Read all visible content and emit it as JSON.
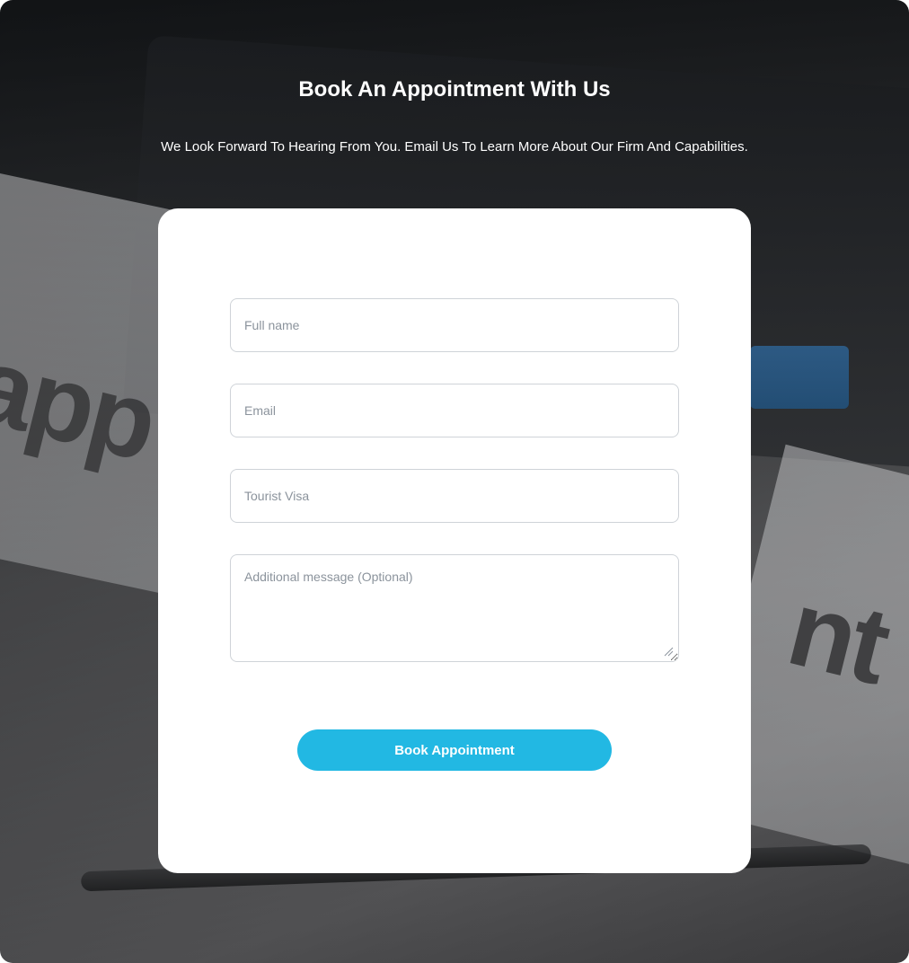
{
  "header": {
    "title": "Book An Appointment With Us",
    "subtitle": "We Look Forward To Hearing From You. Email Us To Learn More About Our Firm And Capabilities."
  },
  "background": {
    "image_word_left": "app",
    "image_word_right": "nt"
  },
  "form": {
    "full_name_placeholder": "Full name",
    "email_placeholder": "Email",
    "visa_placeholder": "Tourist Visa",
    "message_placeholder": "Additional message (Optional)",
    "submit_label": "Book Appointment"
  },
  "colors": {
    "accent": "#22b8e3",
    "card": "#ffffff",
    "input_border": "#cfd3d8",
    "placeholder": "#8b939c"
  }
}
